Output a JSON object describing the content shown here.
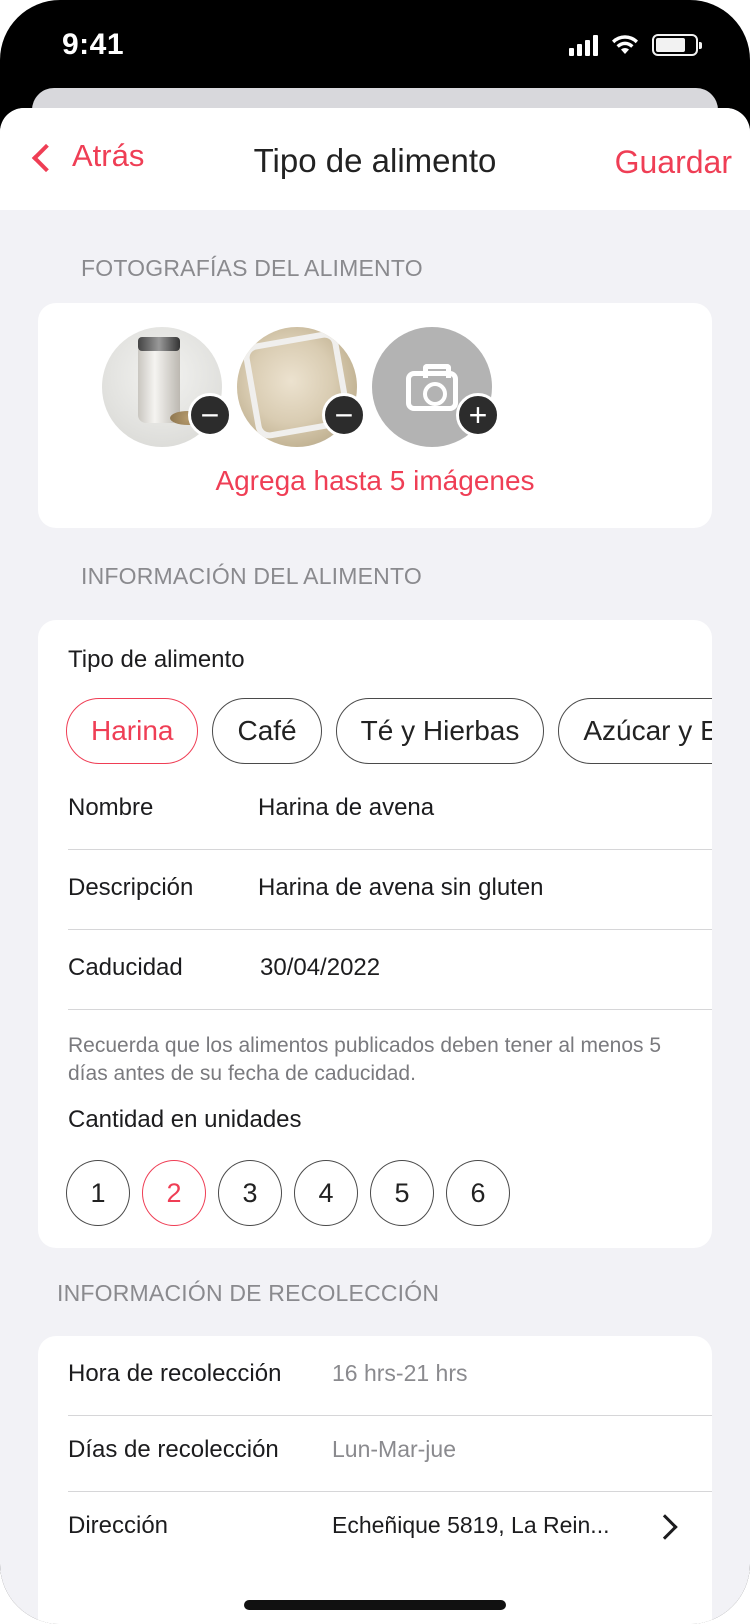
{
  "status": {
    "time": "9:41",
    "signal_icon": "signal-icon",
    "wifi_icon": "wifi-icon",
    "battery_icon": "battery-icon"
  },
  "nav": {
    "back_label": "Atrás",
    "title": "Tipo de alimento",
    "save_label": "Guardar"
  },
  "photos": {
    "header": "FOTOGRAFÍAS DEL ALIMENTO",
    "hint": "Agrega hasta 5 imágenes",
    "remove_symbol": "−",
    "add_symbol": "+"
  },
  "info": {
    "header": "INFORMACIÓN DEL ALIMENTO",
    "type_label": "Tipo de alimento",
    "types": [
      "Harina",
      "Café",
      "Té y Hierbas",
      "Azúcar y E"
    ],
    "selected_type": "Harina",
    "name_label": "Nombre",
    "name_value": "Harina de avena",
    "desc_label": "Descripción",
    "desc_value": "Harina de avena sin gluten",
    "expiry_label": "Caducidad",
    "expiry_value": "30/04/2022",
    "note": "Recuerda que los alimentos publicados deben tener al menos 5 días antes de su fecha de caducidad.",
    "qty_label": "Cantidad en unidades",
    "quantities": [
      "1",
      "2",
      "3",
      "4",
      "5",
      "6"
    ],
    "selected_qty": "2"
  },
  "pickup": {
    "header": "INFORMACIÓN DE RECOLECCIÓN",
    "time_label": "Hora de recolección",
    "time_value": "16 hrs-21 hrs",
    "days_label": "Días de recolección",
    "days_value": "Lun-Mar-jue",
    "address_label": "Dirección",
    "address_value": "Echeñique 5819, La Rein..."
  },
  "colors": {
    "accent": "#ef3e55",
    "background": "#f2f2f6",
    "secondary_text": "#8a8a8e"
  }
}
